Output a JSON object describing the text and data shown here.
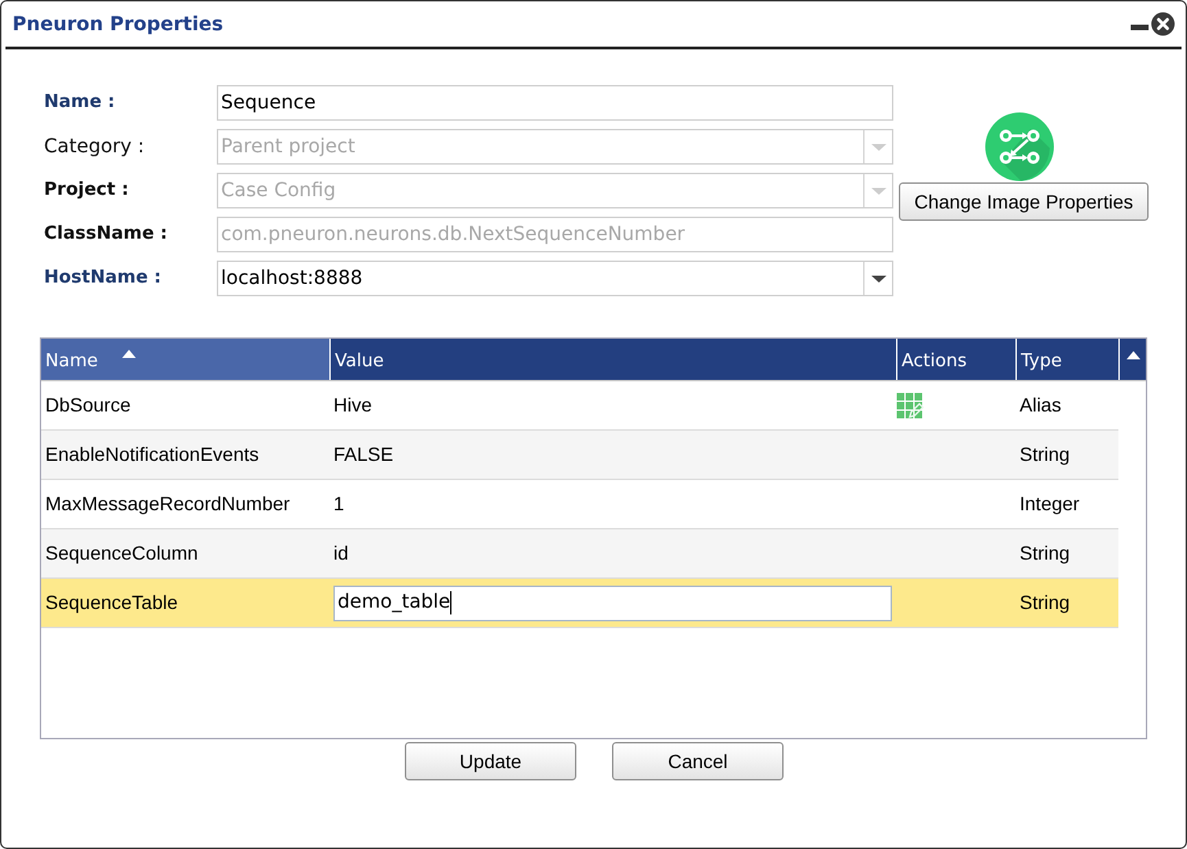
{
  "window": {
    "title": "Pneuron Properties"
  },
  "form": {
    "fields": [
      {
        "label": "Name :",
        "bold": true,
        "highlighted": true,
        "kind": "text",
        "value": "Sequence",
        "disabled": false
      },
      {
        "label": "Category :",
        "bold": false,
        "highlighted": false,
        "kind": "dropdown",
        "value": "Parent project",
        "disabled": true
      },
      {
        "label": "Project :",
        "bold": true,
        "highlighted": false,
        "kind": "dropdown",
        "value": "Case Config",
        "disabled": true
      },
      {
        "label": "ClassName :",
        "bold": true,
        "highlighted": false,
        "kind": "text",
        "value": "com.pneuron.neurons.db.NextSequenceNumber",
        "disabled": true
      },
      {
        "label": "HostName :",
        "bold": true,
        "highlighted": true,
        "kind": "dropdown",
        "value": "localhost:8888",
        "disabled": false
      }
    ]
  },
  "image": {
    "button": "Change Image Properties"
  },
  "table": {
    "columns": [
      {
        "label": "Name",
        "sorted": true
      },
      {
        "label": "Value",
        "sorted": false
      },
      {
        "label": "Actions",
        "sorted": false
      },
      {
        "label": "Type",
        "sorted": false
      }
    ],
    "rows": [
      {
        "name": "DbSource",
        "value": "Hive",
        "action": true,
        "type": "Alias",
        "selected": false,
        "editing": false
      },
      {
        "name": "EnableNotificationEvents",
        "value": "FALSE",
        "action": false,
        "type": "String",
        "selected": false,
        "editing": false
      },
      {
        "name": "MaxMessageRecordNumber",
        "value": "1",
        "action": false,
        "type": "Integer",
        "selected": false,
        "editing": false
      },
      {
        "name": "SequenceColumn",
        "value": "id",
        "action": false,
        "type": "String",
        "selected": false,
        "editing": false
      },
      {
        "name": "SequenceTable",
        "value": "demo_table",
        "action": false,
        "type": "String",
        "selected": true,
        "editing": true
      }
    ]
  },
  "buttons": [
    "Update",
    "Cancel"
  ]
}
